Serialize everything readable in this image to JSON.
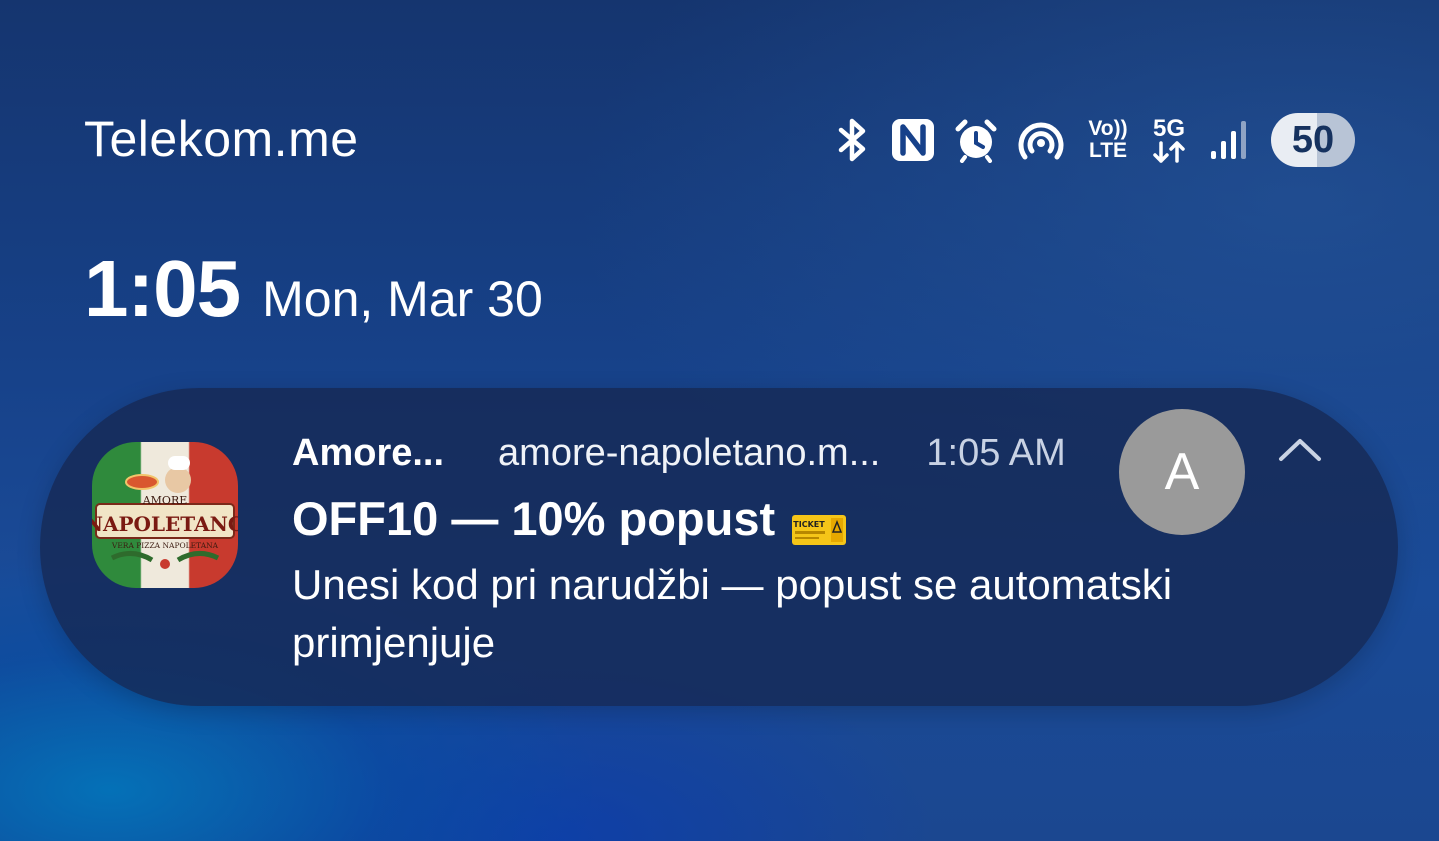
{
  "status_bar": {
    "carrier": "Telekom.me",
    "battery_level": "50",
    "icons": [
      "bluetooth-icon",
      "nfc-icon",
      "alarm-icon",
      "hotspot-icon",
      "volte-icon",
      "5g-data-icon",
      "signal-icon"
    ],
    "volte_top": "Vo))",
    "volte_bottom": "LTE",
    "network_type": "5G"
  },
  "clock": {
    "time": "1:05",
    "date": "Mon, Mar 30"
  },
  "notification": {
    "app_name": "Amore...",
    "sender": "amore-napoletano.m...",
    "time": "1:05 AM",
    "title": "OFF10 — 10% popust",
    "title_emoji": "ticket-icon",
    "body": "Unesi kod pri narudžbi — popust se automatski primjenjuje",
    "avatar_letter": "A",
    "app_icon_text": {
      "top": "AMORE",
      "main": "NAPOLETANO",
      "bottom": "VERA PIZZA NAPOLETANA"
    },
    "emoji_text": "TICKET",
    "colors": {
      "card": "#162852",
      "avatar": "#9a9a9a"
    }
  }
}
